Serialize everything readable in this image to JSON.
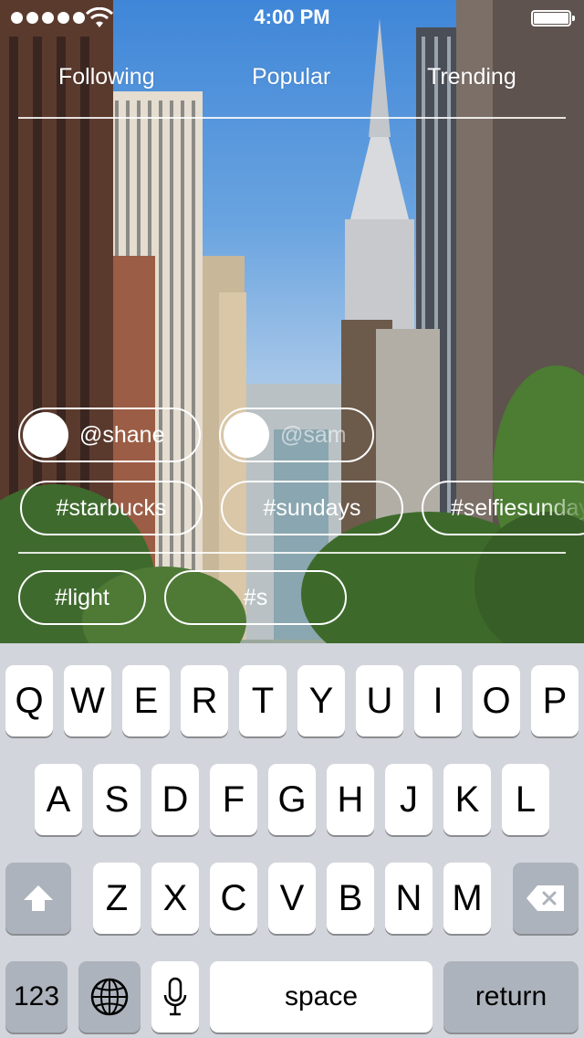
{
  "status_bar": {
    "time": "4:00 PM"
  },
  "tabs": [
    {
      "label": "Following"
    },
    {
      "label": "Popular"
    },
    {
      "label": "Trending"
    }
  ],
  "suggestions": {
    "users": [
      {
        "handle": "@shane"
      },
      {
        "handle": "@sam"
      }
    ],
    "hashtags": [
      {
        "tag": "#starbucks"
      },
      {
        "tag": "#sundays"
      },
      {
        "tag": "#selfiesunday"
      }
    ]
  },
  "entered_tags": [
    {
      "tag": "#light"
    }
  ],
  "current_input": {
    "value": "#s"
  },
  "keyboard": {
    "row1": [
      "Q",
      "W",
      "E",
      "R",
      "T",
      "Y",
      "U",
      "I",
      "O",
      "P"
    ],
    "row2": [
      "A",
      "S",
      "D",
      "F",
      "G",
      "H",
      "J",
      "K",
      "L"
    ],
    "row3": [
      "Z",
      "X",
      "C",
      "V",
      "B",
      "N",
      "M"
    ],
    "numbers_label": "123",
    "space_label": "space",
    "return_label": "return"
  }
}
